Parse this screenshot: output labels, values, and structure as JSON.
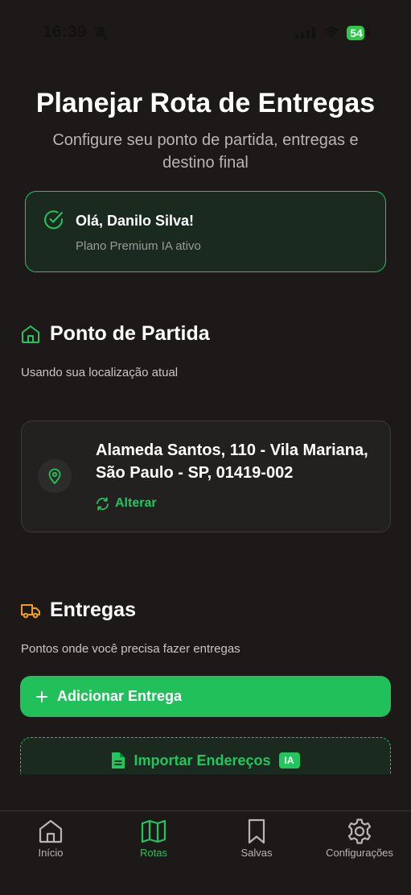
{
  "status_bar": {
    "time": "16:39",
    "battery": "54"
  },
  "header": {
    "title": "Planejar Rota de Entregas",
    "subtitle": "Configure seu ponto de partida, entregas e destino final"
  },
  "greeting": {
    "title": "Olá, Danilo Silva!",
    "plan": "Plano Premium IA ativo"
  },
  "start_point": {
    "title": "Ponto de Partida",
    "subtitle": "Usando sua localização atual",
    "address": "Alameda Santos, 110 - Vila Mariana, São Paulo - SP, 01419-002",
    "change_label": "Alterar"
  },
  "deliveries": {
    "title": "Entregas",
    "subtitle": "Pontos onde você precisa fazer entregas",
    "add_label": "Adicionar Entrega",
    "import_label": "Importar Endereços",
    "import_badge": "IA"
  },
  "tab_bar": {
    "tabs": [
      {
        "label": "Início",
        "icon": "home-icon"
      },
      {
        "label": "Rotas",
        "icon": "map-icon",
        "active": true
      },
      {
        "label": "Salvas",
        "icon": "bookmark-icon"
      },
      {
        "label": "Configurações",
        "icon": "gear-icon"
      }
    ]
  },
  "colors": {
    "accent": "#22c55e",
    "warning": "#f59e0b",
    "background": "#1c1918"
  }
}
